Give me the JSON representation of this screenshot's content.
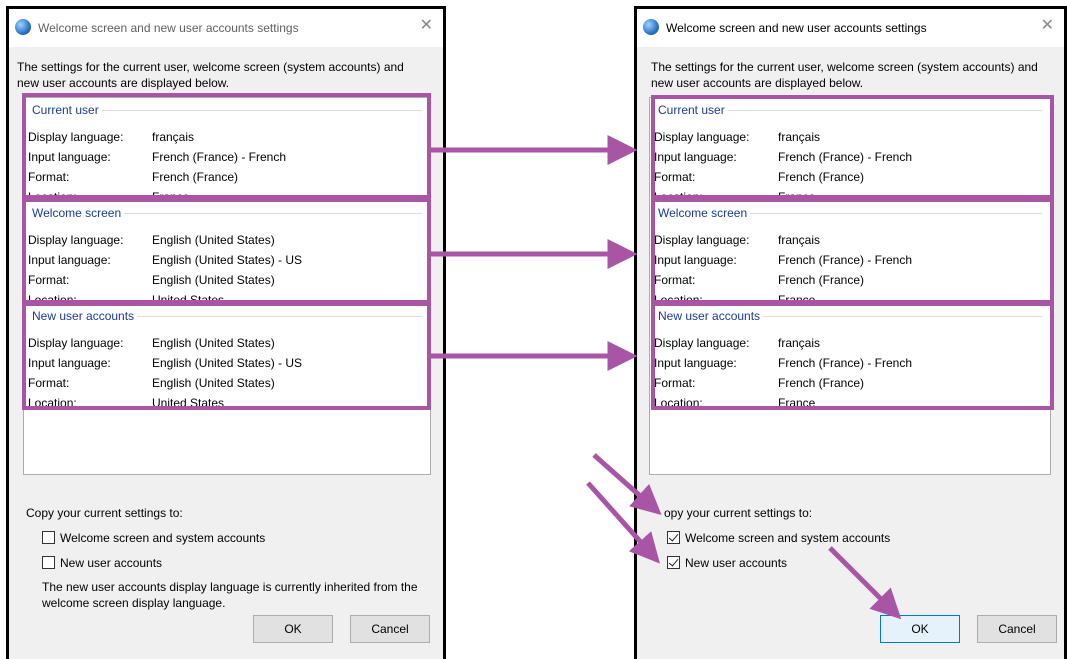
{
  "dialog_title": "Welcome screen and new user accounts settings",
  "close_glyph": "✕",
  "description": "The settings for the current user, welcome screen (system accounts) and new user accounts are displayed below.",
  "labels": {
    "display_language": "Display language:",
    "input_language": "Input language:",
    "format": "Format:",
    "location": "Location:"
  },
  "before": {
    "current_user": {
      "heading": "Current user",
      "display": "français",
      "input": "French (France) - French",
      "format": "French (France)",
      "location": "France"
    },
    "welcome_screen": {
      "heading": "Welcome screen",
      "display": "English (United States)",
      "input": "English (United States) - US",
      "format": "English (United States)",
      "location": "United States"
    },
    "new_user": {
      "heading": "New user accounts",
      "display": "English (United States)",
      "input": "English (United States) - US",
      "format": "English (United States)",
      "location": "United States"
    }
  },
  "after": {
    "current_user": {
      "heading": "Current user",
      "display": "français",
      "input": "French (France) - French",
      "format": "French (France)",
      "location": "France"
    },
    "welcome_screen": {
      "heading": "Welcome screen",
      "display": "français",
      "input": "French (France) - French",
      "format": "French (France)",
      "location": "France"
    },
    "new_user": {
      "heading": "New user accounts",
      "display": "français",
      "input": "French (France) - French",
      "format": "French (France)",
      "location": "France"
    }
  },
  "copy_heading": "Copy your current settings to:",
  "copy_heading_right": "opy your current settings to:",
  "checkbox_welcome": "Welcome screen and system accounts",
  "checkbox_new_users": "New user accounts",
  "checked_left": {
    "welcome": false,
    "new_users": false
  },
  "checked_right": {
    "welcome": true,
    "new_users": true
  },
  "inherit_note": "The new user accounts display language is currently inherited from the welcome screen display language.",
  "ok_label": "OK",
  "cancel_label": "Cancel",
  "annotation_color": "#a855a5",
  "app_icon": "globe-icon"
}
